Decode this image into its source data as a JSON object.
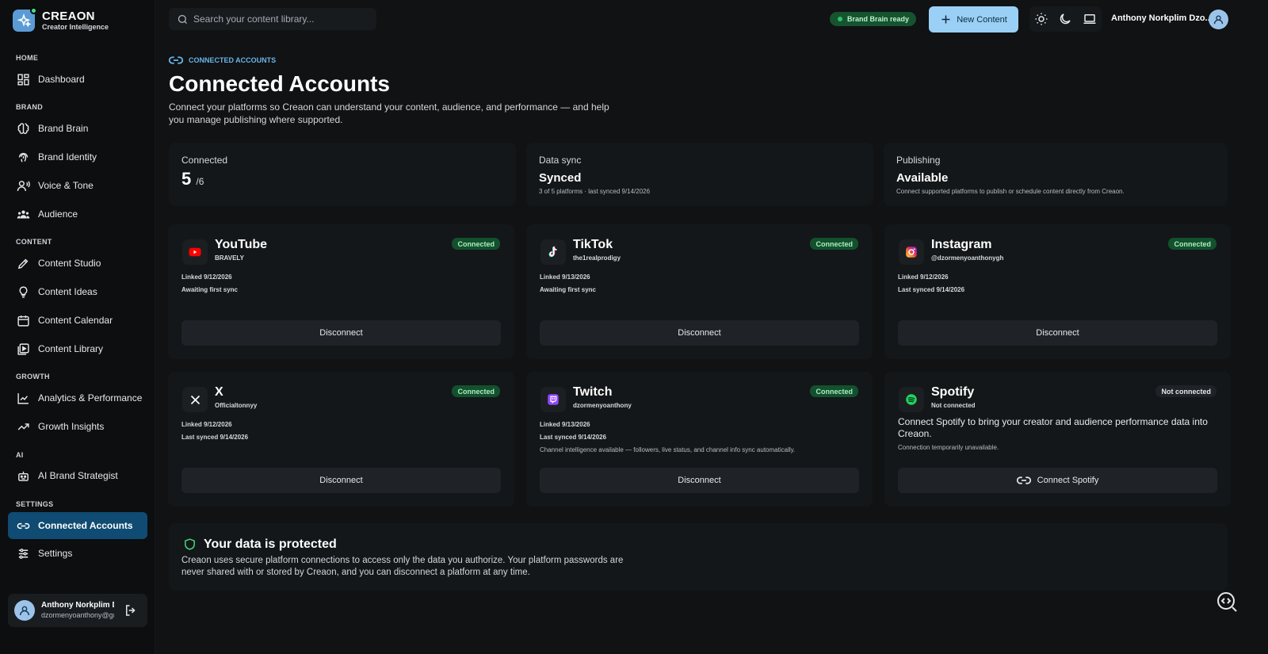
{
  "app": {
    "name": "CREAON",
    "tagline": "Creator Intelligence"
  },
  "search": {
    "placeholder": "Search your content library..."
  },
  "header": {
    "brain_status": "Brand Brain ready",
    "new_content": "New Content",
    "user_name": "Anthony Norkplim Dzo..."
  },
  "sidebar": {
    "sections": {
      "home": "HOME",
      "brand": "BRAND",
      "content": "CONTENT",
      "growth": "GROWTH",
      "ai": "AI",
      "settings": "SETTINGS"
    },
    "items": {
      "dashboard": "Dashboard",
      "brand_brain": "Brand Brain",
      "brand_identity": "Brand Identity",
      "voice_tone": "Voice & Tone",
      "audience": "Audience",
      "content_studio": "Content Studio",
      "content_ideas": "Content Ideas",
      "content_calendar": "Content Calendar",
      "content_library": "Content Library",
      "analytics": "Analytics & Performance",
      "growth_insights": "Growth Insights",
      "ai_strategist": "AI Brand Strategist",
      "connected_accounts": "Connected Accounts",
      "settings": "Settings"
    },
    "user": {
      "name": "Anthony Norkplim Dzormenyo",
      "email": "dzormenyoanthony@gmail.com"
    }
  },
  "page": {
    "breadcrumb": "CONNECTED ACCOUNTS",
    "title": "Connected Accounts",
    "description": "Connect your platforms so Creaon can understand your content, audience, and performance — and help you manage publishing where supported."
  },
  "stats": {
    "connected": {
      "label": "Connected",
      "value": "5",
      "total": "/6"
    },
    "sync": {
      "label": "Data sync",
      "value": "Synced",
      "detail": "3 of 5 platforms · last synced 9/14/2026"
    },
    "publishing": {
      "label": "Publishing",
      "value": "Available",
      "detail": "Connect supported platforms to publish or schedule content directly from Creaon."
    }
  },
  "accounts": {
    "youtube": {
      "name": "YouTube",
      "handle": "BRAVELY",
      "status": "Connected",
      "line1": "Linked 9/12/2026",
      "line2": "Awaiting first sync",
      "action": "Disconnect"
    },
    "tiktok": {
      "name": "TikTok",
      "handle": "the1realprodigy",
      "status": "Connected",
      "line1": "Linked 9/13/2026",
      "line2": "Awaiting first sync",
      "action": "Disconnect"
    },
    "instagram": {
      "name": "Instagram",
      "handle": "@dzormenyoanthonygh",
      "status": "Connected",
      "line1": "Linked 9/12/2026",
      "line2": "Last synced 9/14/2026",
      "action": "Disconnect"
    },
    "x": {
      "name": "X",
      "handle": "Officialtonnyy",
      "status": "Connected",
      "line1": "Linked 9/12/2026",
      "line2": "Last synced 9/14/2026",
      "action": "Disconnect"
    },
    "twitch": {
      "name": "Twitch",
      "handle": "dzormenyoanthony",
      "status": "Connected",
      "line1": "Linked 9/13/2026",
      "line2": "Last synced 9/14/2026",
      "note": "Channel intelligence available — followers, live status, and channel info sync automatically.",
      "action": "Disconnect"
    },
    "spotify": {
      "name": "Spotify",
      "handle": "Not connected",
      "status": "Not connected",
      "cta": "Connect Spotify to bring your creator and audience performance data into Creaon.",
      "note": "Connection temporarily unavailable.",
      "action": "Connect Spotify"
    }
  },
  "protection": {
    "title": "Your data is protected",
    "text": "Creaon uses secure platform connections to access only the data you authorize. Your platform passwords are never shared with or stored by Creaon, and you can disconnect a platform at any time."
  },
  "colors": {
    "accent": "#9ad0f5",
    "active_nav": "#0f4b72",
    "success": "#13502d",
    "background": "#101214"
  }
}
